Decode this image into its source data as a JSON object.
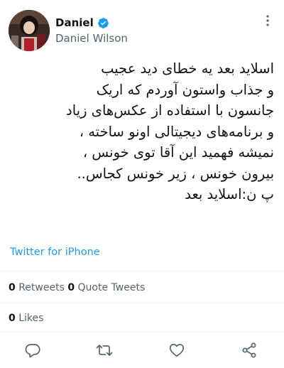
{
  "author": {
    "display_name": "Daniel",
    "handle": "Daniel Wilson",
    "verified": true
  },
  "tweet": {
    "text": "اسلاید بعد یه خطای دید عجیب\nو جذاب واستون آوردم که اریک\nجانسون با استفاده از عکس‌های زیاد\nو برنامه‌های دیجیتالی اونو ساخته ،\nنمیشه فهمید این آقا توی خونس ،\nبیرون خونس ، زیر خونس کجاس..\nپ ن:اسلاید بعد",
    "source": "Twitter for iPhone"
  },
  "stats": {
    "retweets_count": "0",
    "retweets_label": "Retweets",
    "quote_count": "0",
    "quote_label": "Quote Tweets",
    "likes_count": "0",
    "likes_label": "Likes"
  },
  "icons": {
    "more": "vertical-dots-icon",
    "reply": "comment-icon",
    "retweet": "retweet-icon",
    "like": "heart-icon",
    "share": "share-icon",
    "verified": "verified-badge-icon"
  },
  "colors": {
    "accent": "#1d9bf0",
    "text": "#0f1419",
    "secondary": "#536471",
    "divider": "#eff3f4"
  }
}
